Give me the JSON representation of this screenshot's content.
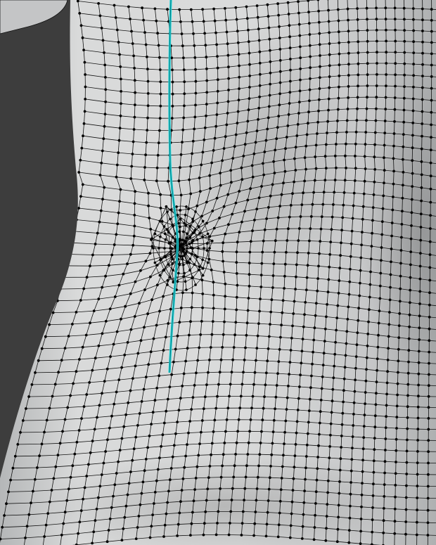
{
  "viewport": {
    "mode": "edit-mode",
    "shading": "solid",
    "overlay": "wireframe-vertices",
    "selection": "edge-loop"
  },
  "colors": {
    "background": "#3d3d3d",
    "mesh_light": "#dcdddd",
    "mesh_mid": "#c9cacb",
    "mesh_dark": "#a9abac",
    "edge": "#111111",
    "vertex": "#000000",
    "selected_edge": "#1fd3d8",
    "strap": "#c4c5c6"
  }
}
